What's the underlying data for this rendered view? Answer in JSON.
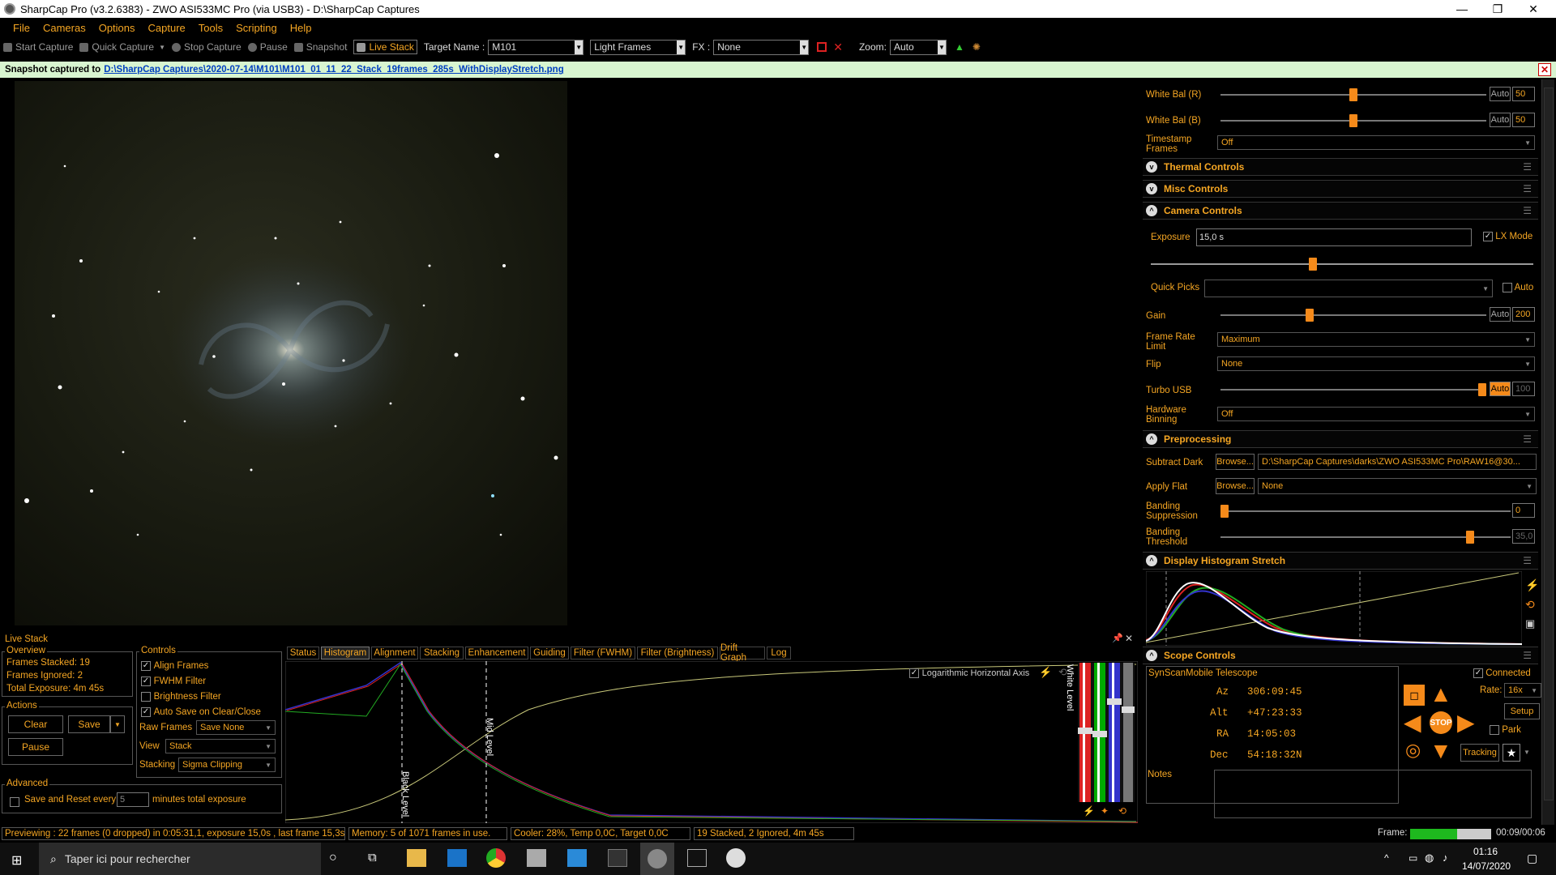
{
  "window": {
    "title": "SharpCap Pro (v3.2.6383) - ZWO ASI533MC Pro (via USB3) - D:\\SharpCap Captures",
    "minimize": "—",
    "maximize": "❐",
    "close": "✕"
  },
  "menu": [
    "File",
    "Cameras",
    "Options",
    "Capture",
    "Tools",
    "Scripting",
    "Help"
  ],
  "toolbar": {
    "start_capture": "Start Capture",
    "quick_capture": "Quick Capture",
    "stop_capture": "Stop Capture",
    "pause": "Pause",
    "snapshot": "Snapshot",
    "live_stack": "Live Stack",
    "target_name_label": "Target Name :",
    "target_name": "M101",
    "frame_type": "Light Frames",
    "fx_label": "FX :",
    "fx": "None",
    "zoom_label": "Zoom:",
    "zoom": "Auto"
  },
  "infobar": {
    "prefix": "Snapshot captured to",
    "path": "D:\\SharpCap Captures\\2020-07-14\\M101\\M101_01_11_22_Stack_19frames_285s_WithDisplayStretch.png"
  },
  "right_panel": {
    "white_bal_r": {
      "label": "White Bal (R)",
      "auto": "Auto",
      "value": "50",
      "level": 0.5
    },
    "white_bal_b": {
      "label": "White Bal (B)",
      "auto": "Auto",
      "value": "50",
      "level": 0.5
    },
    "timestamp": {
      "label": "Timestamp Frames",
      "value": "Off"
    },
    "sections": {
      "thermal": "Thermal Controls",
      "misc": "Misc Controls",
      "camera": "Camera Controls",
      "preprocessing": "Preprocessing",
      "histogram": "Display Histogram Stretch",
      "scope": "Scope Controls"
    },
    "exposure": {
      "label": "Exposure",
      "value": "15,0 s",
      "lx_mode": "LX Mode"
    },
    "quick_picks": {
      "label": "Quick Picks",
      "auto": "Auto"
    },
    "gain": {
      "label": "Gain",
      "auto": "Auto",
      "value": "200",
      "level": 0.33
    },
    "frame_rate": {
      "label": "Frame Rate Limit",
      "value": "Maximum"
    },
    "flip": {
      "label": "Flip",
      "value": "None"
    },
    "turbo_usb": {
      "label": "Turbo USB",
      "auto": "Auto",
      "value": "100",
      "level": 1.0
    },
    "binning": {
      "label": "Hardware Binning",
      "value": "Off"
    },
    "subtract_dark": {
      "label": "Subtract Dark",
      "browse": "Browse...",
      "value": "D:\\SharpCap Captures\\darks\\ZWO ASI533MC Pro\\RAW16@30..."
    },
    "apply_flat": {
      "label": "Apply Flat",
      "browse": "Browse...",
      "value": "None"
    },
    "banding_suppression": {
      "label": "Banding Suppression",
      "value": "0",
      "level": 0.0
    },
    "banding_threshold": {
      "label": "Banding Threshold",
      "value": "35,0",
      "level": 0.87
    },
    "scope": {
      "name": "SynScanMobile Telescope",
      "connected": "Connected",
      "az_label": "Az",
      "az": "306:09:45",
      "alt_label": "Alt",
      "alt": "+47:23:33",
      "ra_label": "RA",
      "ra": "14:05:03",
      "dec_label": "Dec",
      "dec": "54:18:32N",
      "rate_label": "Rate:",
      "rate": "16x",
      "setup": "Setup",
      "park": "Park",
      "tracking": "Tracking",
      "stop": "STOP"
    },
    "notes_label": "Notes"
  },
  "live_stack": {
    "title": "Live Stack",
    "overview": {
      "title": "Overview",
      "frames_stacked": "Frames Stacked: 19",
      "frames_ignored": "Frames Ignored:  2",
      "total_exposure": "Total Exposure:  4m 45s"
    },
    "actions": {
      "title": "Actions",
      "clear": "Clear",
      "save": "Save",
      "pause": "Pause"
    },
    "advanced": {
      "title": "Advanced",
      "save_reset": "Save and Reset every",
      "minutes_value": "5",
      "minutes_label": "minutes total exposure"
    },
    "controls": {
      "title": "Controls",
      "align": "Align Frames",
      "fwhm": "FWHM Filter",
      "brightness": "Brightness Filter",
      "autosave": "Auto Save on Clear/Close",
      "raw_label": "Raw Frames",
      "raw": "Save None",
      "view_label": "View",
      "view": "Stack",
      "stacking_label": "Stacking",
      "stacking": "Sigma Clipping"
    },
    "tabs": [
      "Status",
      "Histogram",
      "Alignment",
      "Stacking",
      "Enhancement",
      "Guiding",
      "Filter (FWHM)",
      "Filter (Brightness)",
      "Drift Graph",
      "Log"
    ],
    "log_horizontal": "Logarithmic Horizontal Axis",
    "black_level": "Black Level",
    "mid_level": "Mid Level",
    "white_level": "White Level"
  },
  "status": {
    "preview": "Previewing : 22 frames (0 dropped) in 0:05:31,1, exposure 15,0s , last frame 15,3s",
    "memory": "Memory: 5 of 1071 frames in use.",
    "cooler": "Cooler: 28%, Temp 0,0C, Target 0,0C",
    "stacked": "19 Stacked, 2 Ignored, 4m 45s",
    "frame_label": "Frame:",
    "frame_time": "00:09/00:06",
    "frame_level": 0.58
  },
  "taskbar": {
    "search": "Taper ici pour rechercher",
    "time": "01:16",
    "date": "14/07/2020"
  },
  "colors": {
    "accent": "#f5a623",
    "slider": "#f58a1a",
    "infobar": "#d8f5d0"
  }
}
